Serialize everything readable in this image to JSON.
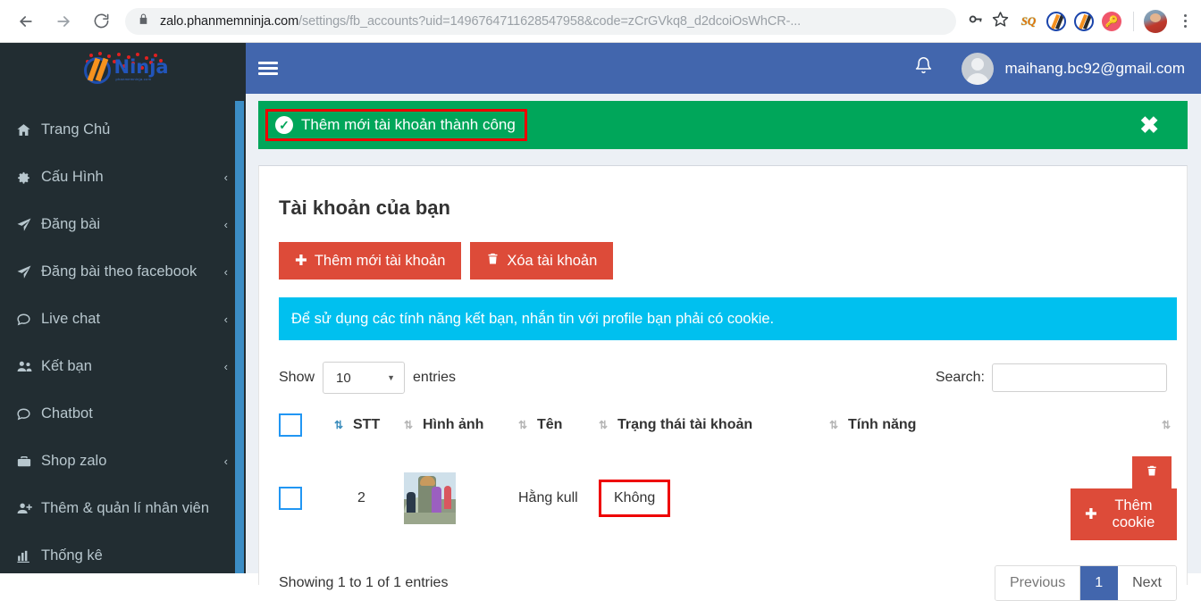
{
  "browser": {
    "back_icon": "back-arrow-icon",
    "forward_icon": "forward-arrow-icon",
    "reload_icon": "reload-icon",
    "lock_icon": "lock-icon",
    "url_host": "zalo.phanmemninja.com",
    "url_path": "/settings/fb_accounts?uid=1496764711628547958&code=zCrGVkq8_d2dcoiOsWhCR-...",
    "key_icon": "key-icon",
    "bookmark_icon": "star-icon",
    "ext_sq_label": "SQ",
    "menu_icon": "kebab-menu-icon"
  },
  "sidebar": {
    "logo_text": "Ninja",
    "logo_sub": "phanmemninja.com",
    "items": [
      {
        "label": "Trang Chủ",
        "icon": "home-icon",
        "caret": ""
      },
      {
        "label": "Cấu Hình",
        "icon": "gear-icon",
        "caret": "‹"
      },
      {
        "label": "Đăng bài",
        "icon": "paper-plane-icon",
        "caret": "‹"
      },
      {
        "label": "Đăng bài theo facebook",
        "icon": "paper-plane-icon",
        "caret": "‹"
      },
      {
        "label": "Live chat",
        "icon": "comment-icon",
        "caret": "‹"
      },
      {
        "label": "Kết bạn",
        "icon": "users-icon",
        "caret": "‹"
      },
      {
        "label": "Chatbot",
        "icon": "comment-icon",
        "caret": ""
      },
      {
        "label": "Shop zalo",
        "icon": "briefcase-icon",
        "caret": "‹"
      },
      {
        "label": "Thêm & quản lí nhân viên",
        "icon": "user-plus-icon",
        "caret": ""
      },
      {
        "label": "Thống kê",
        "icon": "bar-chart-icon",
        "caret": ""
      }
    ]
  },
  "topbar": {
    "hamburger_icon": "hamburger-menu-icon",
    "bell_icon": "bell-icon",
    "avatar_icon": "user-avatar-icon",
    "user_email": "maihang.bc92@gmail.com"
  },
  "alert": {
    "check_icon": "check-circle-icon",
    "message": "Thêm mới tài khoản thành công",
    "close_label": "✖",
    "bg_color": "#00a65a",
    "highlight_color": "#ee0000"
  },
  "main": {
    "card_title": "Tài khoản của bạn",
    "btn_add_label": "Thêm mới tài khoản",
    "btn_add_icon": "plus-icon",
    "btn_delete_label": "Xóa tài khoản",
    "btn_delete_icon": "trash-icon",
    "info_message": "Để sử dụng các tính năng kết bạn, nhắn tin với profile bạn phải có cookie.",
    "info_bg_color": "#00c0ef",
    "btn_color": "#dd4b39"
  },
  "table_controls": {
    "show_label": "Show",
    "entries_value": "10",
    "entries_label": "entries",
    "caret_icon": "chevron-down-icon",
    "search_label": "Search:",
    "search_value": "",
    "search_placeholder": ""
  },
  "table": {
    "columns": [
      "",
      "STT",
      "Hình ảnh",
      "Tên",
      "Trạng thái tài khoản",
      "Tính năng",
      ""
    ],
    "rows": [
      {
        "stt": "2",
        "image": "account-thumbnail",
        "ten": "Hằng kull",
        "trang_thai": "Không",
        "delete_icon": "trash-icon",
        "cookie_icon": "plus-icon",
        "cookie_label": "Thêm cookie"
      }
    ]
  },
  "footer": {
    "showing_info": "Showing 1 to 1 of 1 entries",
    "previous_label": "Previous",
    "page_label": "1",
    "next_label": "Next"
  }
}
